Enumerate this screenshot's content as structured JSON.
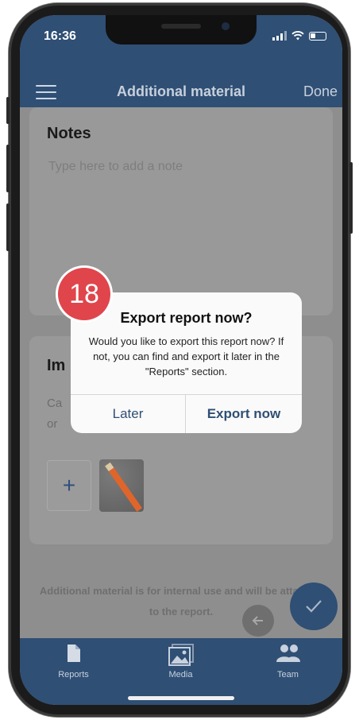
{
  "status_bar": {
    "time": "16:36"
  },
  "nav": {
    "title": "Additional material",
    "done_label": "Done"
  },
  "notes_card": {
    "title": "Notes",
    "placeholder": "Type here to add a note"
  },
  "images_card": {
    "title": "Im",
    "description": "Ca\nor"
  },
  "footer_note": "Additional material is for internal use and will be attached to the report.",
  "dialog": {
    "title": "Export report now?",
    "message": "Would you like to export this report now? If not, you can find and export it later in the \"Reports\" section.",
    "later_label": "Later",
    "export_label": "Export now"
  },
  "step_badge": "18",
  "tabs": [
    {
      "label": "Reports",
      "icon": "document-icon"
    },
    {
      "label": "Media",
      "icon": "image-icon"
    },
    {
      "label": "Team",
      "icon": "team-icon"
    }
  ],
  "colors": {
    "brand": "#2f4f74",
    "badge": "#e0454c",
    "overlay_bg": "#8e8e8e"
  }
}
